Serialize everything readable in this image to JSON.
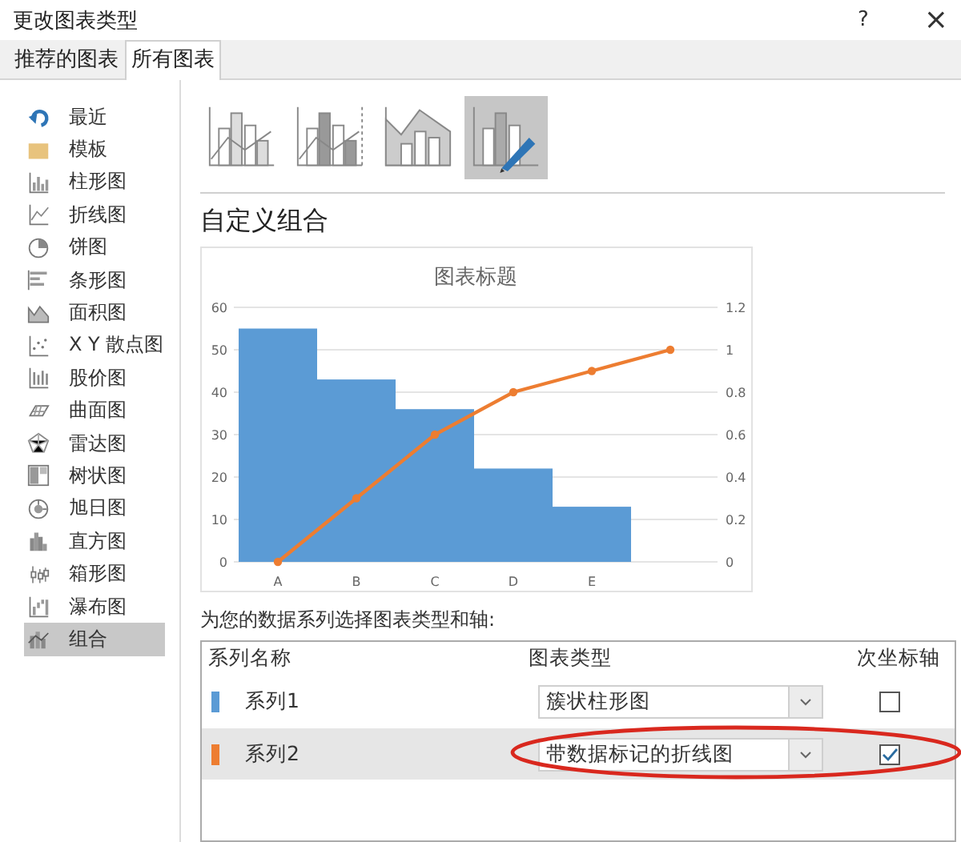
{
  "window": {
    "title": "更改图表类型",
    "help": "?",
    "close": "×"
  },
  "tabs": [
    {
      "label": "推荐的图表",
      "selected": false
    },
    {
      "label": "所有图表",
      "selected": true
    }
  ],
  "sidebar": {
    "items": [
      {
        "label": "最近",
        "kind": "recent",
        "selected": false
      },
      {
        "label": "模板",
        "kind": "template",
        "selected": false
      },
      {
        "label": "柱形图",
        "kind": "column",
        "selected": false
      },
      {
        "label": "折线图",
        "kind": "line",
        "selected": false
      },
      {
        "label": "饼图",
        "kind": "pie",
        "selected": false
      },
      {
        "label": "条形图",
        "kind": "bar",
        "selected": false
      },
      {
        "label": "面积图",
        "kind": "area",
        "selected": false
      },
      {
        "label": "X Y 散点图",
        "kind": "scatter",
        "selected": false
      },
      {
        "label": "股价图",
        "kind": "stock",
        "selected": false
      },
      {
        "label": "曲面图",
        "kind": "surface",
        "selected": false
      },
      {
        "label": "雷达图",
        "kind": "radar",
        "selected": false
      },
      {
        "label": "树状图",
        "kind": "treemap",
        "selected": false
      },
      {
        "label": "旭日图",
        "kind": "sunburst",
        "selected": false
      },
      {
        "label": "直方图",
        "kind": "histogram",
        "selected": false
      },
      {
        "label": "箱形图",
        "kind": "box",
        "selected": false
      },
      {
        "label": "瀑布图",
        "kind": "waterfall",
        "selected": false
      },
      {
        "label": "组合",
        "kind": "combo",
        "selected": true
      }
    ]
  },
  "subtypes": [
    {
      "kind": "column-line",
      "selected": false
    },
    {
      "kind": "column-line-secondary",
      "selected": false
    },
    {
      "kind": "area-column",
      "selected": false
    },
    {
      "kind": "custom",
      "selected": true
    }
  ],
  "heading": "自定义组合",
  "chart": {
    "chart_data": {
      "type": "bar",
      "title": "图表标题",
      "categories": [
        "A",
        "B",
        "C",
        "D",
        "E",
        null
      ],
      "series": [
        {
          "color": "#5b9bd5",
          "values": [
            55,
            43,
            36,
            22,
            13,
            null
          ]
        },
        {
          "color": "#ed7d31",
          "type": "line",
          "marker": "circle",
          "axis": "y2",
          "values": [
            0,
            0.3,
            0.6,
            0.8,
            0.9,
            1
          ]
        }
      ],
      "grid": true,
      "ylim": [
        0,
        60
      ],
      "yticks": [
        0,
        10,
        20,
        30,
        40,
        50,
        60
      ],
      "y2lim": [
        0,
        1.2
      ],
      "y2ticks": [
        0,
        0.2,
        0.4,
        0.6,
        0.8,
        1,
        1.2
      ]
    }
  },
  "series_prompt": "为您的数据系列选择图表类型和轴:",
  "series_table": {
    "columns": [
      "系列名称",
      "图表类型",
      "次坐标轴"
    ],
    "rows": [
      {
        "name": "系列1",
        "color": "#5b9bd5",
        "chart_type": "簇状柱形图",
        "secondary_axis": false,
        "selected": false
      },
      {
        "name": "系列2",
        "color": "#ed7d31",
        "chart_type": "带数据标记的折线图",
        "secondary_axis": true,
        "selected": true
      }
    ]
  }
}
